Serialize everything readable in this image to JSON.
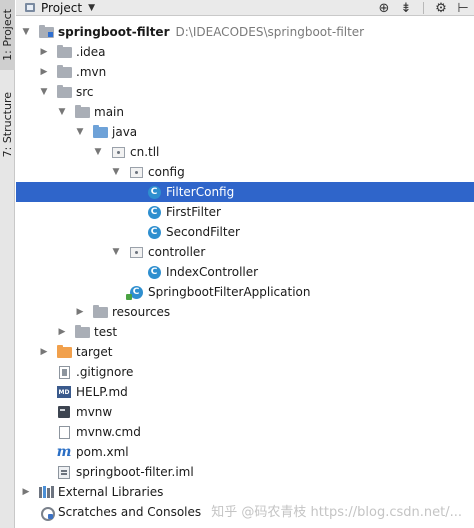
{
  "sidebar": {
    "project_tab": "1: Project",
    "structure_tab": "7: Structure"
  },
  "header": {
    "title": "Project",
    "dropdown_icon": "chevron-down-icon",
    "tools": [
      {
        "name": "locate-icon",
        "glyph": "⊕"
      },
      {
        "name": "collapse-all-icon",
        "glyph": "⇟"
      },
      {
        "name": "gear-icon",
        "glyph": "⚙"
      },
      {
        "name": "hide-icon",
        "glyph": "⊢"
      }
    ]
  },
  "tree": [
    {
      "depth": 0,
      "arrow": "down",
      "icon": "module-folder",
      "label": "springboot-filter",
      "bold": true,
      "path": "D:\\IDEACODES\\springboot-filter"
    },
    {
      "depth": 1,
      "arrow": "right",
      "icon": "folder",
      "label": ".idea"
    },
    {
      "depth": 1,
      "arrow": "right",
      "icon": "folder",
      "label": ".mvn"
    },
    {
      "depth": 1,
      "arrow": "down",
      "icon": "folder",
      "label": "src"
    },
    {
      "depth": 2,
      "arrow": "down",
      "icon": "folder",
      "label": "main"
    },
    {
      "depth": 3,
      "arrow": "down",
      "icon": "folder-blue",
      "label": "java"
    },
    {
      "depth": 4,
      "arrow": "down",
      "icon": "package",
      "label": "cn.tll"
    },
    {
      "depth": 5,
      "arrow": "down",
      "icon": "package",
      "label": "config"
    },
    {
      "depth": 6,
      "arrow": "none",
      "icon": "class",
      "label": "FilterConfig",
      "selected": true
    },
    {
      "depth": 6,
      "arrow": "none",
      "icon": "class",
      "label": "FirstFilter"
    },
    {
      "depth": 6,
      "arrow": "none",
      "icon": "class",
      "label": "SecondFilter"
    },
    {
      "depth": 5,
      "arrow": "down",
      "icon": "package",
      "label": "controller"
    },
    {
      "depth": 6,
      "arrow": "none",
      "icon": "class",
      "label": "IndexController"
    },
    {
      "depth": 5,
      "arrow": "none",
      "icon": "class-run",
      "label": "SpringbootFilterApplication"
    },
    {
      "depth": 3,
      "arrow": "right",
      "icon": "folder",
      "label": "resources"
    },
    {
      "depth": 2,
      "arrow": "right",
      "icon": "folder",
      "label": "test"
    },
    {
      "depth": 1,
      "arrow": "right",
      "icon": "folder-orange",
      "label": "target"
    },
    {
      "depth": 1,
      "arrow": "none",
      "icon": "file-gitignore",
      "label": ".gitignore"
    },
    {
      "depth": 1,
      "arrow": "none",
      "icon": "file-md",
      "label": "HELP.md"
    },
    {
      "depth": 1,
      "arrow": "none",
      "icon": "file-terminal",
      "label": "mvnw"
    },
    {
      "depth": 1,
      "arrow": "none",
      "icon": "file",
      "label": "mvnw.cmd"
    },
    {
      "depth": 1,
      "arrow": "none",
      "icon": "file-maven",
      "label": "pom.xml"
    },
    {
      "depth": 1,
      "arrow": "none",
      "icon": "file-iml",
      "label": "springboot-filter.iml"
    },
    {
      "depth": 0,
      "arrow": "right",
      "icon": "libraries",
      "label": "External Libraries"
    },
    {
      "depth": 0,
      "arrow": "none",
      "icon": "scratches",
      "label": "Scratches and Consoles"
    }
  ],
  "watermark": "知乎 @码农青枝  https://blog.csdn.net/..."
}
